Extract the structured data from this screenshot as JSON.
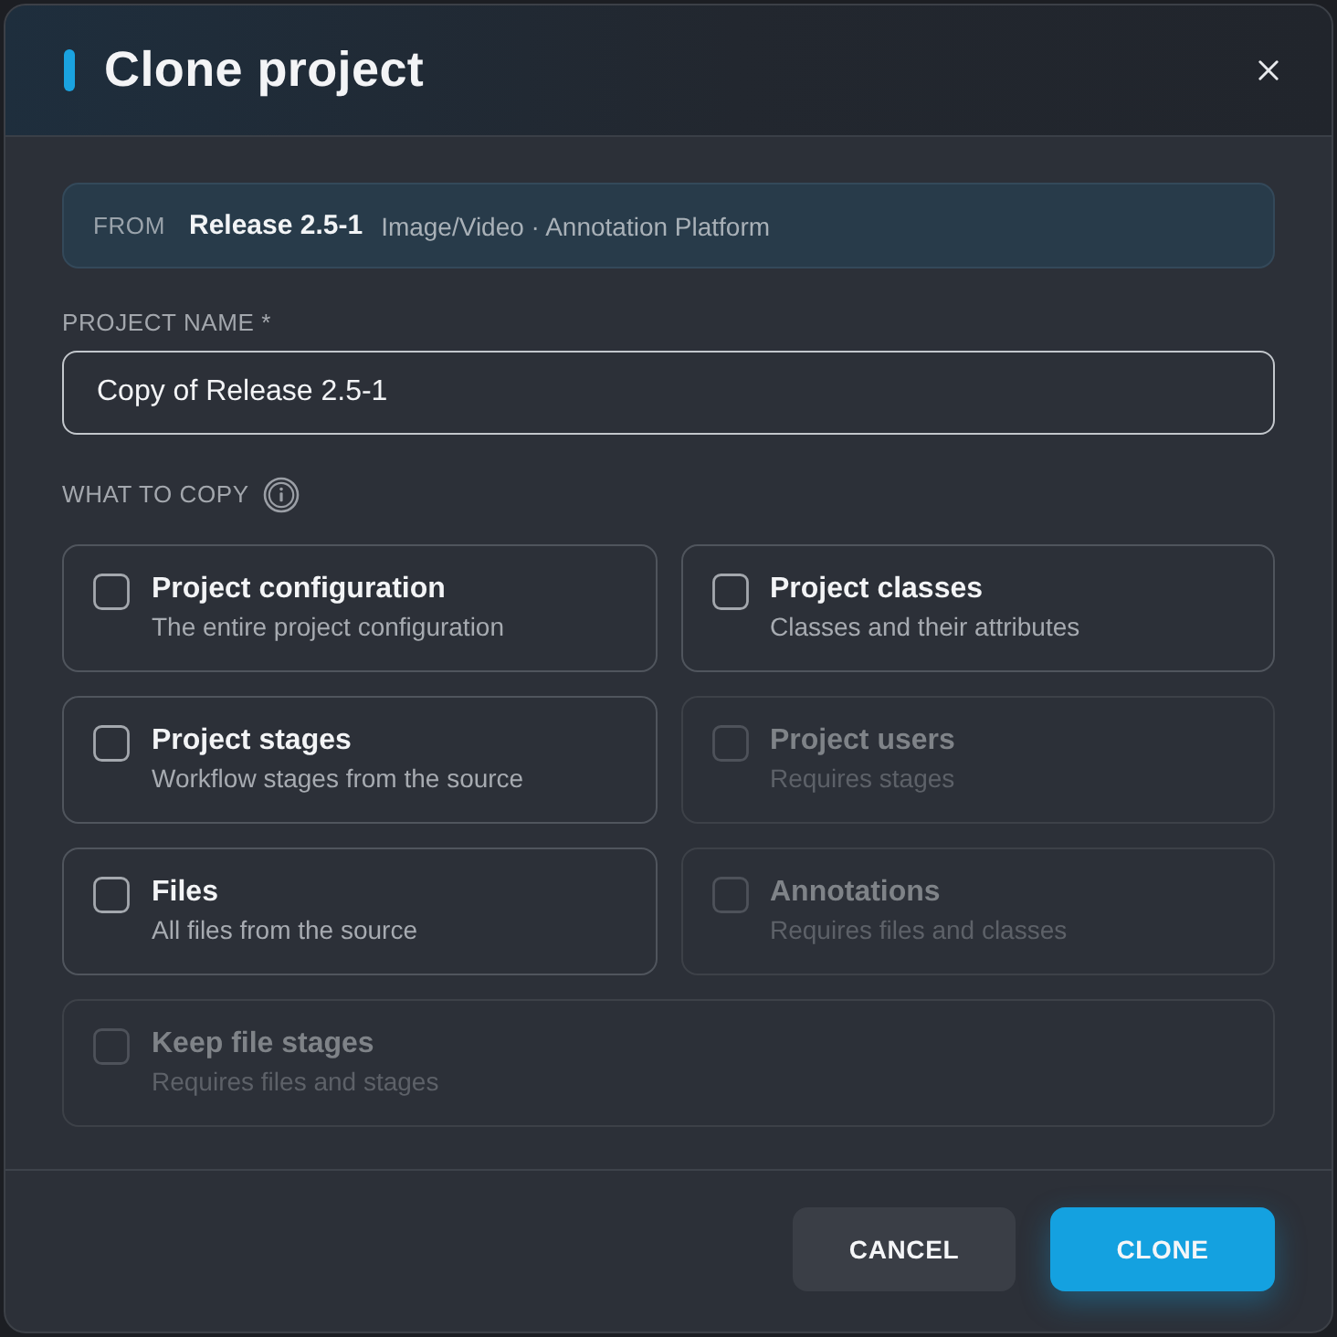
{
  "dialog": {
    "title": "Clone project"
  },
  "source": {
    "label": "FROM",
    "name": "Release 2.5-1",
    "details": "Image/Video · Annotation Platform"
  },
  "project_name": {
    "label": "PROJECT NAME *",
    "value": "Copy of Release 2.5-1"
  },
  "what_to_copy": {
    "label": "WHAT TO COPY",
    "options": [
      {
        "title": "Project configuration",
        "description": "The entire project configuration",
        "checked": false,
        "disabled": false
      },
      {
        "title": "Project classes",
        "description": "Classes and their attributes",
        "checked": false,
        "disabled": false
      },
      {
        "title": "Project stages",
        "description": "Workflow stages from the source",
        "checked": false,
        "disabled": false
      },
      {
        "title": "Project users",
        "description": "Requires stages",
        "checked": false,
        "disabled": true
      },
      {
        "title": "Files",
        "description": "All files from the source",
        "checked": false,
        "disabled": false
      },
      {
        "title": "Annotations",
        "description": "Requires files and classes",
        "checked": false,
        "disabled": true
      },
      {
        "title": "Keep file stages",
        "description": "Requires files and stages",
        "checked": false,
        "disabled": true
      }
    ]
  },
  "buttons": [
    {
      "label": "CANCEL",
      "kind": "secondary"
    },
    {
      "label": "CLONE",
      "kind": "primary"
    }
  ]
}
